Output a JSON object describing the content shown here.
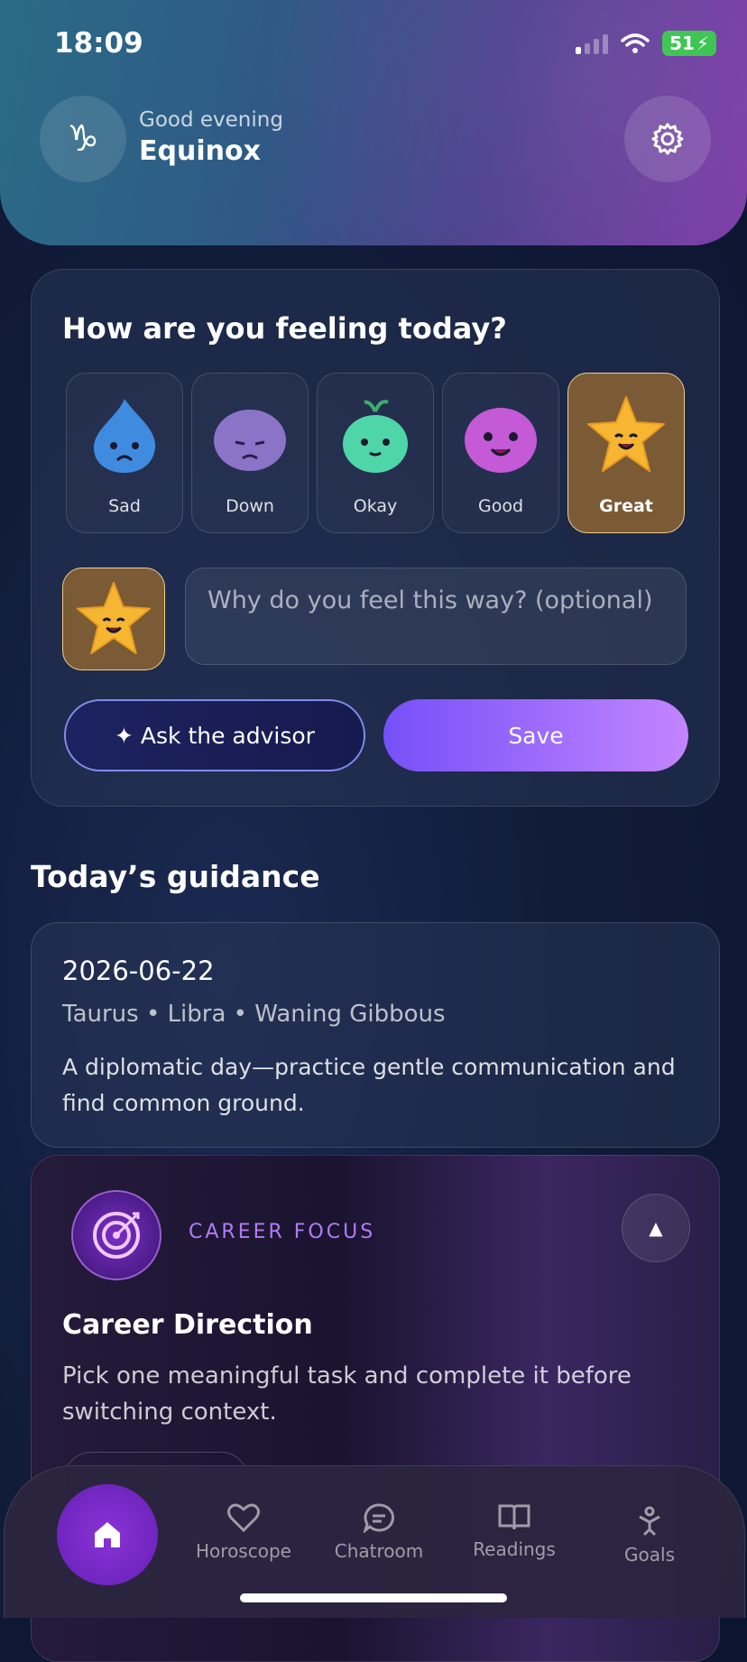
{
  "status_bar": {
    "time": "18:09",
    "battery": "51"
  },
  "header": {
    "greeting": "Good evening",
    "name": "Equinox",
    "zodiac_glyph": "♑"
  },
  "mood": {
    "title": "How are you feeling today?",
    "options": [
      {
        "label": "Sad",
        "color": "#3f8be0"
      },
      {
        "label": "Down",
        "color": "#8b74c8"
      },
      {
        "label": "Okay",
        "color": "#4fd6a8"
      },
      {
        "label": "Good",
        "color": "#c45ad6"
      },
      {
        "label": "Great",
        "color": "#f6b632"
      }
    ],
    "selected": "Great",
    "reason_placeholder": "Why do you feel this way? (optional)",
    "ask_label": "✦ Ask the advisor",
    "save_label": "Save"
  },
  "guidance": {
    "section_title": "Today’s guidance",
    "date": "2026-06-22",
    "meta": "Taurus • Libra • Waning Gibbous",
    "text": "A diplomatic day—practice gentle communication and find common ground."
  },
  "career": {
    "tag": "CAREER FOCUS",
    "title": "Career Direction",
    "text": "Pick one meaningful task and complete it before switching context.",
    "collapse_glyph": "▲"
  },
  "tabs": [
    {
      "label": "Horoscope"
    },
    {
      "label": "Chatroom"
    },
    {
      "label": "Readings"
    },
    {
      "label": "Goals"
    }
  ]
}
